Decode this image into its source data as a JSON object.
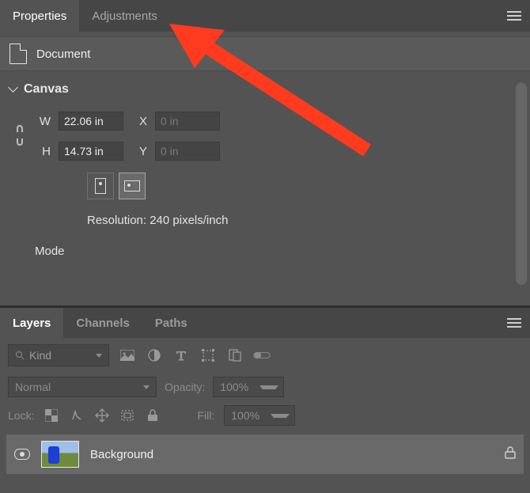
{
  "top": {
    "tabs": {
      "properties": "Properties",
      "adjustments": "Adjustments"
    },
    "document_label": "Document",
    "canvas": {
      "header": "Canvas",
      "w_label": "W",
      "w_value": "22.06 in",
      "h_label": "H",
      "h_value": "14.73 in",
      "x_label": "X",
      "x_value": "0 in",
      "y_label": "Y",
      "y_value": "0 in",
      "resolution_label": "Resolution: 240 pixels/inch",
      "mode_label": "Mode"
    }
  },
  "layers": {
    "tabs": {
      "layers": "Layers",
      "channels": "Channels",
      "paths": "Paths"
    },
    "kind_label": "Kind",
    "blend_mode": "Normal",
    "opacity_label": "Opacity:",
    "opacity_value": "100%",
    "lock_label": "Lock:",
    "fill_label": "Fill:",
    "fill_value": "100%",
    "layer_name": "Background"
  }
}
